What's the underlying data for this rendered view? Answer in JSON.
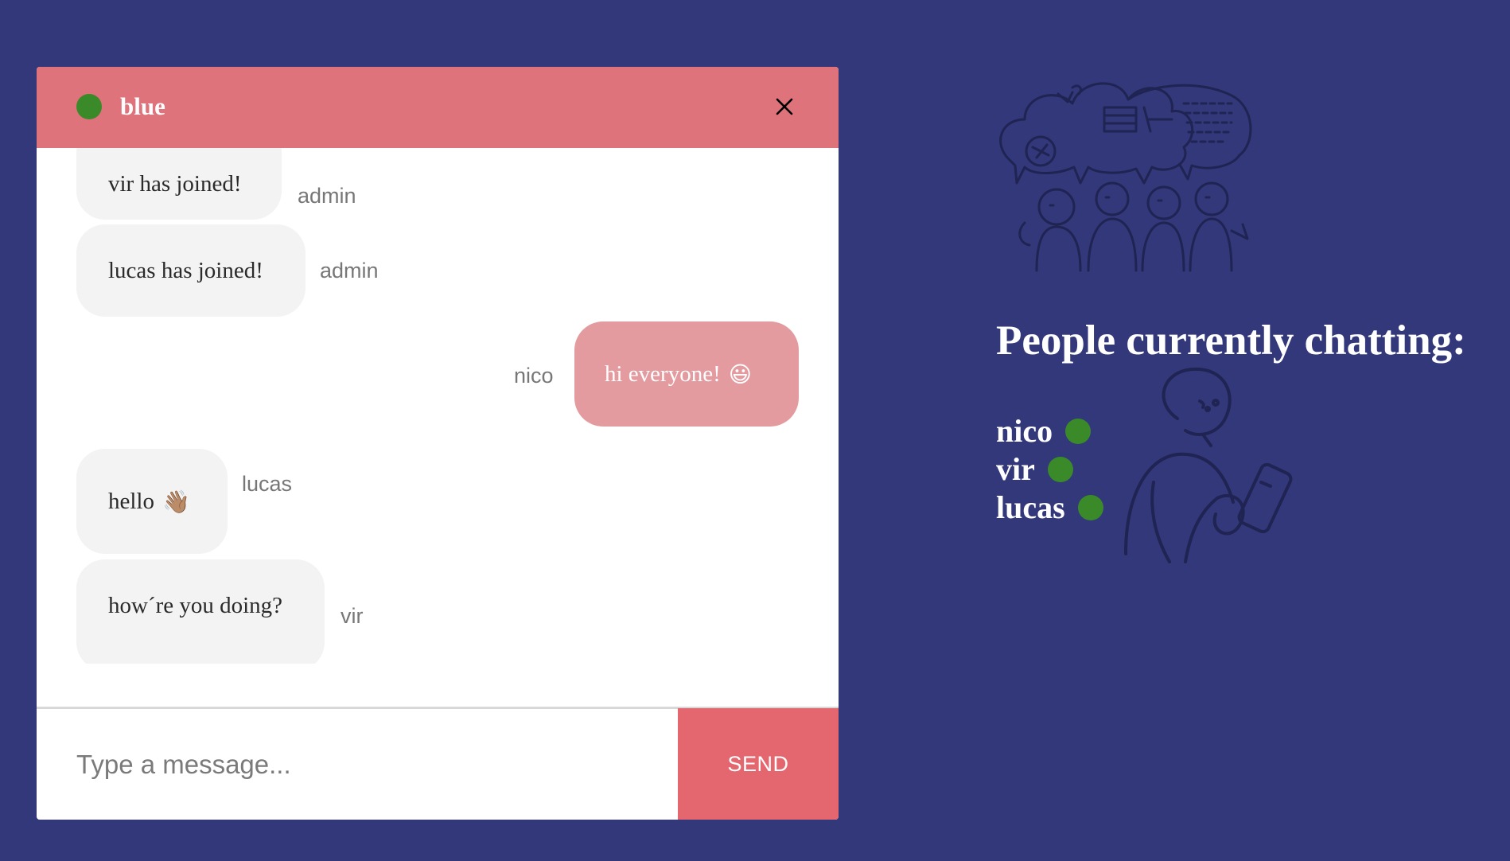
{
  "colors": {
    "background": "#32387a",
    "header": "#de737b",
    "own_bubble": "#e39b9f",
    "other_bubble": "#f3f3f3",
    "send_button": "#e4676f",
    "online": "#3b8a2a"
  },
  "chat": {
    "room_name": "blue",
    "close_label": "✕",
    "messages": [
      {
        "text": "vir has joined!",
        "sender": "admin",
        "own": false
      },
      {
        "text": "lucas has joined!",
        "sender": "admin",
        "own": false
      },
      {
        "text": "hi everyone!",
        "emoji": "😃",
        "sender": "nico",
        "own": true
      },
      {
        "text": "hello",
        "emoji": "👋🏽",
        "sender": "lucas",
        "own": false
      },
      {
        "text": "how´re you doing?",
        "sender": "vir",
        "own": false
      }
    ]
  },
  "composer": {
    "placeholder": "Type a message...",
    "send_label": "SEND"
  },
  "sidebar": {
    "heading": "People currently chatting:",
    "people": [
      {
        "name": "nico",
        "status": "online"
      },
      {
        "name": "vir",
        "status": "online"
      },
      {
        "name": "lucas",
        "status": "online"
      }
    ],
    "illustrations": [
      "chat-crowd-illustration",
      "person-with-phone-illustration"
    ]
  }
}
